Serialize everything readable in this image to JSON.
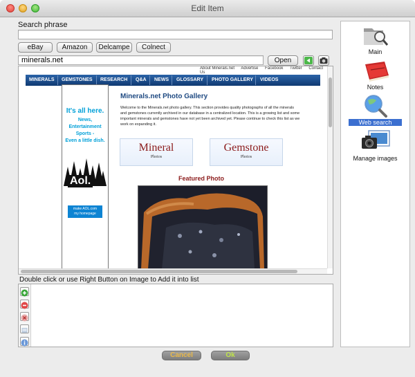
{
  "window": {
    "title": "Edit Item"
  },
  "search": {
    "label": "Search phrase",
    "value": ""
  },
  "sources": {
    "buttons": [
      "eBay",
      "Amazon",
      "Delcampe",
      "Colnect"
    ]
  },
  "url_bar": {
    "value": "minerals.net",
    "open_button": "Open URL"
  },
  "webpage": {
    "top_links": [
      "About Minerals.net",
      "Advertise",
      "Facebook",
      "Twitter",
      "Contact Us"
    ],
    "nav": [
      "MINERALS",
      "GEMSTONES",
      "RESEARCH",
      "Q&A",
      "NEWS",
      "GLOSSARY",
      "PHOTO GALLERY",
      "VIDEOS"
    ],
    "ad": {
      "headline": "It's all here.",
      "body": "News,\nEntertainment\nSports -\nEven a little dish.",
      "logo": "Aol.",
      "cta": "make AOL.com\nmy homepage"
    },
    "gallery_title": "Minerals.net Photo Gallery",
    "intro": "Welcome to the Minerals.net photo gallery. This section provides quality photographs of all the minerals and gemstones currently archived in our database in a centralized location. This is a growing list and some important minerals and gemstones have not yet been archived yet. Please continue to check this list as we work on expanding it.",
    "mineral_button": {
      "title": "Mineral",
      "sub": "Photos"
    },
    "gemstone_button": {
      "title": "Gemstone",
      "sub": "Photos"
    },
    "featured_label": "Featured Photo"
  },
  "hint": "Double click or use Right Button on Image to Add it into list",
  "dialog": {
    "cancel": "Cancel",
    "ok": "Ok",
    "cancel_color": "#e8b84a",
    "ok_color": "#bfe34a"
  },
  "sidebar": {
    "items": [
      {
        "label": "Main",
        "icon": "folder-search-icon",
        "selected": false
      },
      {
        "label": "Notes",
        "icon": "notebook-icon",
        "selected": false
      },
      {
        "label": "Web search",
        "icon": "magnifier-globe-icon",
        "selected": true
      },
      {
        "label": "Manage images",
        "icon": "camera-icon",
        "selected": false
      }
    ]
  },
  "colors": {
    "nav_bar": "#1a4a8a",
    "selection": "#3b6fd0",
    "accent_red": "#8b1a1a",
    "ad_blue": "#00a0d8"
  }
}
